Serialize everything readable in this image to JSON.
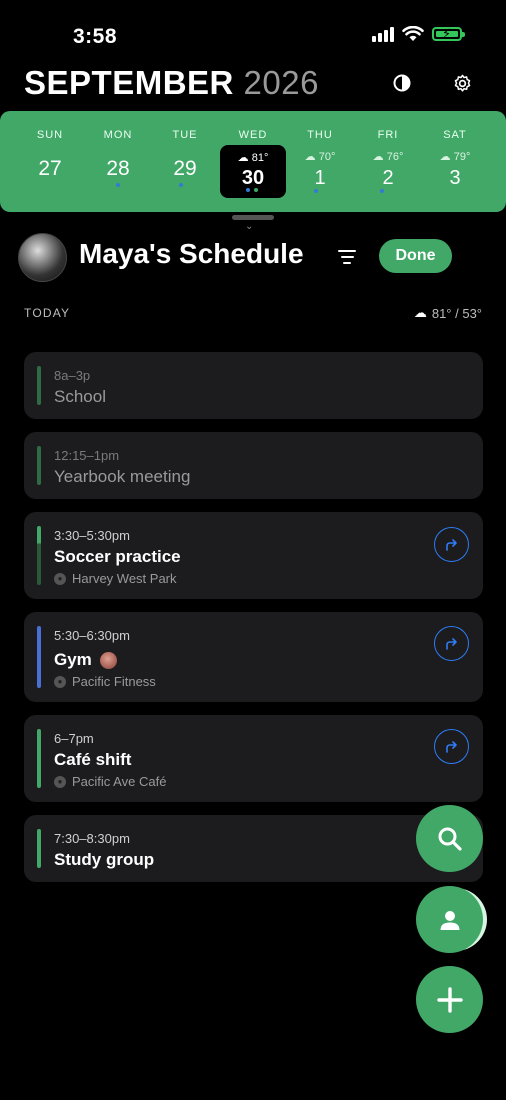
{
  "status": {
    "time": "3:58"
  },
  "header": {
    "month": "SEPTEMBER",
    "year": "2026",
    "theme_icon": "contrast-icon",
    "settings_icon": "gear-icon"
  },
  "week": [
    {
      "dow": "SUN",
      "num": "27",
      "temp": ""
    },
    {
      "dow": "MON",
      "num": "28",
      "temp": ""
    },
    {
      "dow": "TUE",
      "num": "29",
      "temp": ""
    },
    {
      "dow": "WED",
      "num": "30",
      "temp": "81°"
    },
    {
      "dow": "THU",
      "num": "1",
      "temp": "70°"
    },
    {
      "dow": "FRI",
      "num": "2",
      "temp": "76°"
    },
    {
      "dow": "SAT",
      "num": "3",
      "temp": "79°"
    }
  ],
  "person": {
    "name": "Maya's Schedule",
    "done_label": "Done"
  },
  "today": {
    "label": "TODAY",
    "weather": "81° / 53°"
  },
  "events": [
    {
      "time": "8a–3p",
      "title": "School",
      "location": "",
      "color": "#2f6b45"
    },
    {
      "time": "12:15–1pm",
      "title": "Yearbook meeting",
      "location": "",
      "color": "#2f6b45"
    },
    {
      "time": "3:30–5:30pm",
      "title": "Soccer practice",
      "location": "Harvey West Park",
      "color": "#41a868"
    },
    {
      "time": "5:30–6:30pm",
      "title": "Gym",
      "location": "Pacific Fitness",
      "color": "#4a6fd6"
    },
    {
      "time": "6–7pm",
      "title": "Café shift",
      "location": "Pacific Ave Café",
      "color": "#41a868"
    },
    {
      "time": "7:30–8:30pm",
      "title": "Study group",
      "location": "",
      "color": "#41a868"
    }
  ],
  "colors": {
    "accent": "#41a868",
    "link": "#2e7cf6",
    "card": "#1c1c1e"
  }
}
